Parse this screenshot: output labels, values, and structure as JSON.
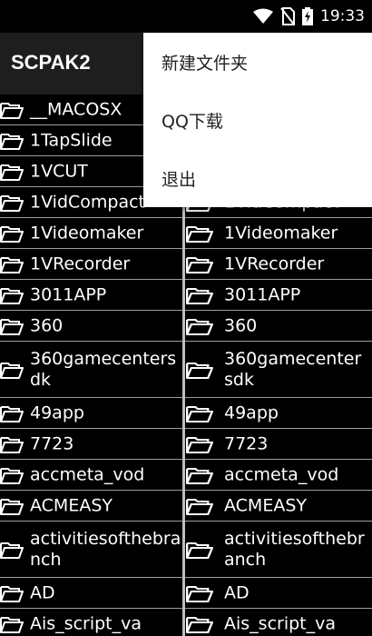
{
  "status": {
    "time": "19:33"
  },
  "app": {
    "title": "SCPAK2"
  },
  "menu": {
    "items": [
      {
        "label": "新建文件夹"
      },
      {
        "label": "QQ下载"
      },
      {
        "label": "退出"
      }
    ]
  },
  "left_items": [
    {
      "name": "__MACOSX"
    },
    {
      "name": "1TapSlide"
    },
    {
      "name": "1VCUT"
    },
    {
      "name": "1VidCompact"
    },
    {
      "name": "1Videomaker"
    },
    {
      "name": "1VRecorder"
    },
    {
      "name": "3011APP"
    },
    {
      "name": "360"
    },
    {
      "name": "360gamecentersdk"
    },
    {
      "name": "49app"
    },
    {
      "name": "7723"
    },
    {
      "name": "accmeta_vod"
    },
    {
      "name": "ACMEASY"
    },
    {
      "name": "activitiesofthebranch"
    },
    {
      "name": "AD"
    },
    {
      "name": "Ais_script_va"
    }
  ],
  "right_items": [
    {
      "name": "1VidCompact"
    },
    {
      "name": "1Videomaker"
    },
    {
      "name": "1VRecorder"
    },
    {
      "name": "3011APP"
    },
    {
      "name": "360"
    },
    {
      "name": "360gamecentersdk"
    },
    {
      "name": "49app"
    },
    {
      "name": "7723"
    },
    {
      "name": "accmeta_vod"
    },
    {
      "name": "ACMEASY"
    },
    {
      "name": "activitiesofthebranch"
    },
    {
      "name": "AD"
    },
    {
      "name": "Ais_script_va"
    }
  ]
}
